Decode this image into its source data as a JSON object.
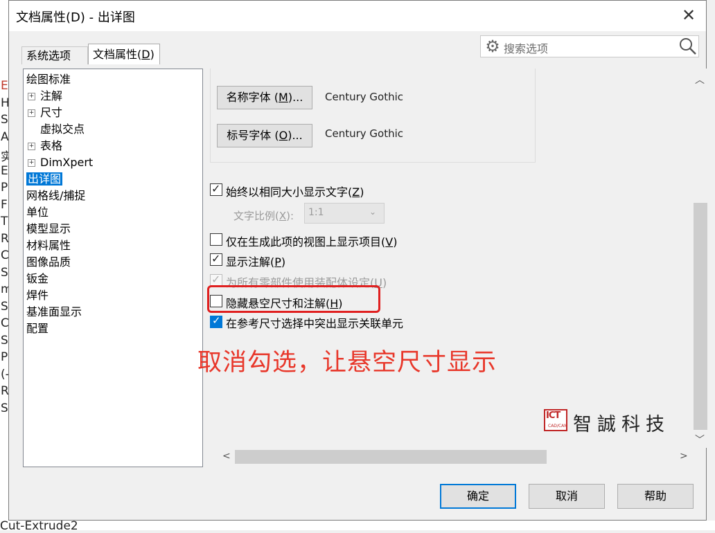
{
  "background_app": {
    "side_letters": [
      "E",
      "H",
      "S",
      "A",
      "实",
      "E",
      "P",
      "F",
      "T",
      "R",
      "C",
      "S",
      "m",
      "S",
      "C",
      "S",
      "P",
      "(-",
      "R",
      "S"
    ],
    "bottom_item": "Cut-Extrude2"
  },
  "dialog": {
    "title": "文档属性(D) - 出详图",
    "close_glyph": "✕"
  },
  "tabs": [
    {
      "label": "系统选项(",
      "key": "S",
      "suffix": ")"
    },
    {
      "label": "文档属性(",
      "key": "D",
      "suffix": ")"
    }
  ],
  "search": {
    "placeholder": "搜索选项"
  },
  "tree": {
    "items": [
      {
        "label": "绘图标准"
      },
      {
        "label": "注解",
        "expandable": true
      },
      {
        "label": "尺寸",
        "expandable": true
      },
      {
        "label": "虚拟交点"
      },
      {
        "label": "表格",
        "expandable": true
      },
      {
        "label": "DimXpert",
        "expandable": true
      },
      {
        "label": "出详图",
        "selected": true
      },
      {
        "label": "网格线/捕捉"
      },
      {
        "label": "单位"
      },
      {
        "label": "模型显示"
      },
      {
        "label": "材料属性"
      },
      {
        "label": "图像品质"
      },
      {
        "label": "钣金"
      },
      {
        "label": "焊件"
      },
      {
        "label": "基准面显示"
      },
      {
        "label": "配置"
      }
    ]
  },
  "fonts": {
    "name_font_button": {
      "label": "名称字体 (",
      "key": "M",
      "suffix": ")..."
    },
    "name_font_value": "Century Gothic",
    "number_font_button": {
      "label": "标号字体 (",
      "key": "O",
      "suffix": ")..."
    },
    "number_font_value": "Century Gothic"
  },
  "options": {
    "same_size_text": {
      "label": "始终以相同大小显示文字(",
      "key": "Z",
      "suffix": ")",
      "checked": true
    },
    "text_scale_label": {
      "label": "文字比例(",
      "key": "X",
      "suffix": "):"
    },
    "text_scale_value": "1:1",
    "only_in_view": {
      "label": "仅在生成此项的视图上显示项目(",
      "key": "V",
      "suffix": ")",
      "checked": false
    },
    "show_annotations": {
      "label": "显示注解(",
      "key": "P",
      "suffix": ")",
      "checked": true
    },
    "use_assembly_settings": {
      "label": "为所有零部件使用装配体设定(",
      "key": "U",
      "suffix": ")",
      "checked": true,
      "disabled": true
    },
    "hide_dangling": {
      "label": "隐藏悬空尺寸和注解(",
      "key": "H",
      "suffix": ")",
      "checked": false
    },
    "highlight_associated": {
      "label": "在参考尺寸选择中突出显示关联单元",
      "checked": true
    }
  },
  "annotation_text": "取消勾选，让悬空尺寸显示",
  "watermark": {
    "logo": "ICT",
    "logo_sub": "CAD/CAM",
    "text": "智誠科技"
  },
  "buttons": {
    "ok": "确定",
    "cancel": "取消",
    "help": "帮助"
  },
  "colors": {
    "selection": "#0078d7",
    "annotation_red": "#e8372a",
    "highlight_border": "#e02020"
  }
}
